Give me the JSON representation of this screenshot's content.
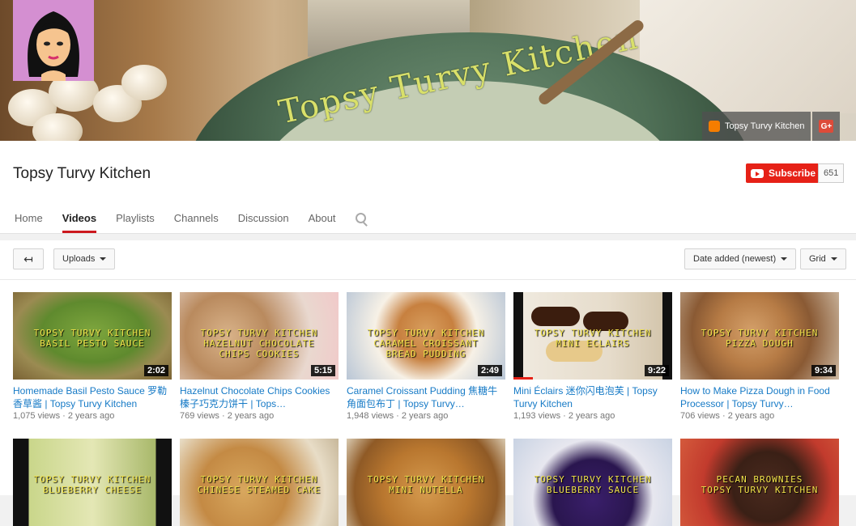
{
  "channel": {
    "name": "Topsy Turvy Kitchen",
    "banner_bowl_text": "Topsy Turvy Kitchen",
    "subscribe_label": "Subscribe",
    "subscriber_count": "651",
    "banner_links": [
      {
        "label": "Topsy Turvy Kitchen",
        "icon": "blogger-icon"
      },
      {
        "label": "G+",
        "icon": "google-plus-icon"
      }
    ]
  },
  "tabs": [
    {
      "label": "Home",
      "active": false
    },
    {
      "label": "Videos",
      "active": true
    },
    {
      "label": "Playlists",
      "active": false
    },
    {
      "label": "Channels",
      "active": false
    },
    {
      "label": "Discussion",
      "active": false
    },
    {
      "label": "About",
      "active": false
    }
  ],
  "toolbar": {
    "uploads_label": "Uploads",
    "sort_label": "Date added (newest)",
    "view_label": "Grid"
  },
  "videos": [
    {
      "overlay1": "TOPSY TURVY KITCHEN",
      "overlay2": "BASIL PESTO SAUCE",
      "overlay3": "",
      "duration": "2:02",
      "title": "Homemade Basil Pesto Sauce 罗勒香草酱 | Topsy Turvy Kitchen",
      "views": "1,075 views",
      "age": "2 years ago"
    },
    {
      "overlay1": "TOPSY TURVY KITCHEN",
      "overlay2": "HAZELNUT CHOCOLATE",
      "overlay3": "CHIPS COOKIES",
      "duration": "5:15",
      "title": "Hazelnut Chocolate Chips Cookies 榛子巧克力饼干 | Tops…",
      "views": "769 views",
      "age": "2 years ago"
    },
    {
      "overlay1": "TOPSY TURVY KITCHEN",
      "overlay2": "CARAMEL CROISSANT",
      "overlay3": "BREAD PUDDING",
      "duration": "2:49",
      "title": "Caramel Croissant Pudding 焦糖牛角面包布丁 | Topsy Turvy…",
      "views": "1,948 views",
      "age": "2 years ago"
    },
    {
      "overlay1": "TOPSY TURVY KITCHEN",
      "overlay2": "MINI ECLAIRS",
      "overlay3": "",
      "duration": "9:22",
      "title": "Mini Éclairs 迷你闪电泡芙 | Topsy Turvy Kitchen",
      "views": "1,193 views",
      "age": "2 years ago"
    },
    {
      "overlay1": "TOPSY TURVY KITCHEN",
      "overlay2": "PIZZA DOUGH",
      "overlay3": "",
      "duration": "9:34",
      "title": "How to Make Pizza Dough in Food Processor | Topsy Turvy…",
      "views": "706 views",
      "age": "2 years ago"
    }
  ],
  "videos_row2": [
    {
      "overlay1": "TOPSY TURVY KITCHEN",
      "overlay2": "BLUEBERRY CHEESE"
    },
    {
      "overlay1": "TOPSY TURVY KITCHEN",
      "overlay2": "CHINESE STEAMED CAKE"
    },
    {
      "overlay1": "TOPSY TURVY KITCHEN",
      "overlay2": "MINI NUTELLA"
    },
    {
      "overlay1": "TOPSY TURVY KITCHEN",
      "overlay2": "BLUEBERRY SAUCE"
    },
    {
      "overlay1": "PECAN BROWNIES",
      "overlay2": "TOPSY TURVY KITCHEN"
    }
  ],
  "colors": {
    "accent": "#cc181e",
    "link": "#167ac6",
    "subscribe": "#e62117"
  }
}
